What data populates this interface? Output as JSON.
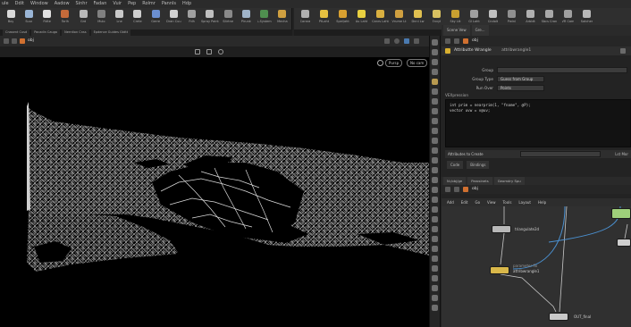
{
  "menubar": {
    "items": [
      "ule",
      "Ddit",
      "Window",
      "Aadow",
      "Sinhr",
      "Fadan",
      "Vuir",
      "Pep",
      "Rolmr",
      "Pannls",
      "Hdp"
    ]
  },
  "shelf_left": {
    "tools": [
      {
        "label": "Boy",
        "icon": "box-icon",
        "color": "#d8d8d8"
      },
      {
        "label": "Suur",
        "icon": "sphere-icon",
        "color": "#9ab5d6"
      },
      {
        "label": "Fidte",
        "icon": "tube-icon",
        "color": "#e0e0e0"
      },
      {
        "label": "Torlh",
        "icon": "torus-icon",
        "color": "#c46a3a"
      },
      {
        "label": "Grd",
        "icon": "grid-icon",
        "color": "#b8b8b8"
      },
      {
        "label": "Mulo",
        "icon": "null-icon",
        "color": "#808080"
      },
      {
        "label": "Lne",
        "icon": "line-icon",
        "color": "#c8c8c8"
      },
      {
        "label": "Crete",
        "icon": "circle-icon",
        "color": "#cfcfcf"
      },
      {
        "label": "Gerre",
        "icon": "curve-icon",
        "color": "#6b8fd1"
      },
      {
        "label": "Dran Cuu",
        "icon": "draw-curve-icon",
        "color": "#d0d0d0"
      },
      {
        "label": "Fdh",
        "icon": "path-icon",
        "color": "#a0a0a0"
      },
      {
        "label": "Spray Paint",
        "icon": "spray-icon",
        "color": "#bfbfbf"
      },
      {
        "label": "Sitrtne",
        "icon": "font-icon",
        "color": "#8a8a8a"
      },
      {
        "label": "Pirunk",
        "icon": "platonic-icon",
        "color": "#9fb3c8"
      },
      {
        "label": "L-System",
        "icon": "lsystem-icon",
        "color": "#4f8f4f"
      },
      {
        "label": "Mecha",
        "icon": "metaball-icon",
        "color": "#d0a040"
      }
    ]
  },
  "shelf_right": {
    "tools": [
      {
        "label": "Carara",
        "icon": "camera-icon",
        "color": "#b0b0b0"
      },
      {
        "label": "PtLaht",
        "icon": "point-light-icon",
        "color": "#e5c040"
      },
      {
        "label": "Spel/aht",
        "icon": "spot-light-icon",
        "color": "#d8a030"
      },
      {
        "label": "Au Laht",
        "icon": "area-light-icon",
        "color": "#e8d040"
      },
      {
        "label": "Canrs Laht",
        "icon": "geometry-light-icon",
        "color": "#d9b040"
      },
      {
        "label": "Vrume Lt",
        "icon": "volume-light-icon",
        "color": "#d0a040"
      },
      {
        "label": "Dnnl Lw",
        "icon": "distant-light-icon",
        "color": "#e0c050"
      },
      {
        "label": "Envyt",
        "icon": "environment-light-icon",
        "color": "#d8c060"
      },
      {
        "label": "Sky Ltt",
        "icon": "sky-light-icon",
        "color": "#c8a030"
      },
      {
        "label": "Gl Laht",
        "icon": "gi-light-icon",
        "color": "#a0a0a0"
      },
      {
        "label": "Cndolt",
        "icon": "caustic-light-icon",
        "color": "#c0c0c0"
      },
      {
        "label": "Pwlnl",
        "icon": "portal-light-icon",
        "color": "#909090"
      },
      {
        "label": "Arbldt",
        "icon": "ambient-light-icon",
        "color": "#b0b0b0"
      },
      {
        "label": "Sbcs Cran",
        "icon": "stereo-camera-icon",
        "color": "#a8a8a8"
      },
      {
        "label": "VR Cam",
        "icon": "vr-camera-icon",
        "color": "#a0a0a0"
      },
      {
        "label": "Sotcher",
        "icon": "switcher-icon",
        "color": "#b8b8b8"
      }
    ]
  },
  "shelf_tabs": [
    "Cnasent Cusd",
    "Pacadin Cauga",
    "Nerrdion Cnss",
    "Epdence Guides Gtdtt"
  ],
  "viewport": {
    "path": "obj",
    "display_label": "Pursp",
    "camera_label": "No cam"
  },
  "params_panel": {
    "tabs": [
      "Scene Vew",
      "Gre..."
    ],
    "path": "obj",
    "node_name": "Attributte Wrangle",
    "node_extra": "attribwrangle1",
    "rows": [
      {
        "label": "Group",
        "value": ""
      },
      {
        "label": "Group Type",
        "value": "Guess from Group"
      },
      {
        "label": "Run Over",
        "value": "Points"
      }
    ],
    "vex_label": "VEXpression",
    "vex_code": "int prim = nearprim(1, \"fname\", @P);\nvector uvw = v@uv;",
    "foot_label": "Attributes to Create",
    "foot_right": "Lst Mor",
    "tab2": [
      "Code",
      "Bindings"
    ]
  },
  "network_panel": {
    "tabs": [
      "N:/obj/ge",
      "Parosinets",
      "Geomdry Spu"
    ],
    "path": "obj",
    "menu": [
      "Add",
      "Edit",
      "Go",
      "View",
      "Tools",
      "Layout",
      "Help"
    ],
    "nodes": [
      {
        "label": "triangulate2d"
      },
      {
        "label": "attribwrangle1",
        "sub": "parameter fix"
      },
      {
        "label": "OUT_final"
      }
    ]
  }
}
